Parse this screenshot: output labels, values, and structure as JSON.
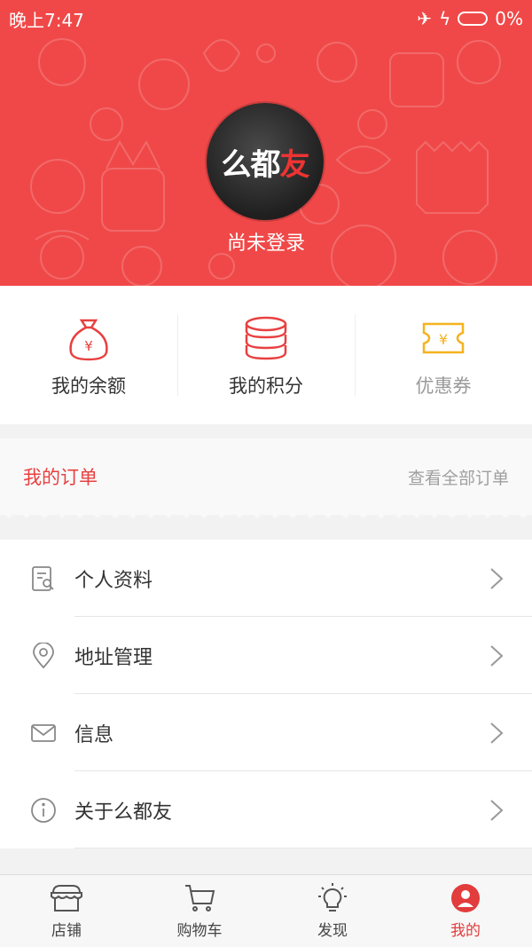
{
  "status_bar": {
    "time": "晚上7:47",
    "battery": "0%"
  },
  "header": {
    "logo_text_a": "么都",
    "logo_text_b": "友",
    "login_text": "尚未登录"
  },
  "quick": [
    {
      "label": "我的余额",
      "icon": "money-bag-icon"
    },
    {
      "label": "我的积分",
      "icon": "coin-stack-icon"
    },
    {
      "label": "优惠券",
      "icon": "coupon-icon"
    }
  ],
  "order": {
    "title": "我的订单",
    "view_all": "查看全部订单"
  },
  "menu": [
    {
      "label": "个人资料",
      "icon": "profile-doc-icon"
    },
    {
      "label": "地址管理",
      "icon": "location-pin-icon"
    },
    {
      "label": "信息",
      "icon": "mail-icon"
    },
    {
      "label": "关于么都友",
      "icon": "info-icon"
    }
  ],
  "tabs": [
    {
      "label": "店铺",
      "icon": "store-icon"
    },
    {
      "label": "购物车",
      "icon": "cart-icon"
    },
    {
      "label": "发现",
      "icon": "lightbulb-icon"
    },
    {
      "label": "我的",
      "icon": "user-icon",
      "active": true
    }
  ],
  "colors": {
    "brand_red": "#f04848",
    "accent_yellow": "#f5b21e"
  }
}
